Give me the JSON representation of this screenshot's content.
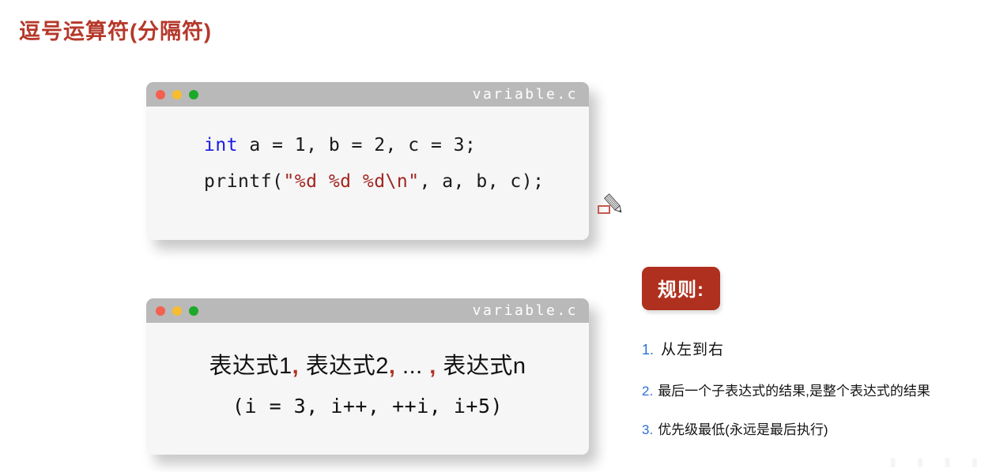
{
  "slide": {
    "title": "逗号运算符(分隔符)",
    "title_color": "#b5382a",
    "background": "#ffffff"
  },
  "windows": [
    {
      "id": "window-1",
      "filename": "variable.c",
      "titlebar_color": "#b9b9b9",
      "body_color": "#f6f6f6",
      "traffic_lights": [
        {
          "name": "close-dot",
          "color": "#f4604f"
        },
        {
          "name": "minimize-dot",
          "color": "#f7bd2e"
        },
        {
          "name": "maximize-dot",
          "color": "#1da82a"
        }
      ],
      "lines": [
        {
          "keyword": "int",
          "rest": " a = 1, b = 2, c = 3;"
        },
        {
          "before": "printf(",
          "string": "\"%d %d %d\\n\"",
          "after": ", a, b, c);"
        }
      ]
    },
    {
      "id": "window-2",
      "filename": "variable.c",
      "titlebar_color": "#b9b9b9",
      "body_color": "#f6f6f6",
      "traffic_lights": [
        {
          "name": "close-dot",
          "color": "#f4604f"
        },
        {
          "name": "minimize-dot",
          "color": "#f7bd2e"
        },
        {
          "name": "maximize-dot",
          "color": "#1da82a"
        }
      ],
      "expression_parts": {
        "p1": "表达式1",
        "c1": ",",
        "p2": " 表达式2",
        "c2": ",",
        "p3": " ...",
        "c3": " ,",
        "p4": " 表达式n"
      },
      "example_line": "(i = 3, i++, ++i, i+5)"
    }
  ],
  "rules": {
    "badge_label": "规则:",
    "badge_color": "#b0301f",
    "number_color": "#2d6fd8",
    "items": [
      {
        "num": "1.",
        "text": "从左到右"
      },
      {
        "num": "2.",
        "text": "最后一个子表达式的结果,是整个表达式的结果"
      },
      {
        "num": "3.",
        "text": "优先级最低(永远是最后执行)"
      }
    ]
  },
  "cursor": {
    "type": "pencil-annotation-cursor",
    "marker_color": "#c45a52"
  },
  "watermark": "▮ ▮ ▮ ▮"
}
